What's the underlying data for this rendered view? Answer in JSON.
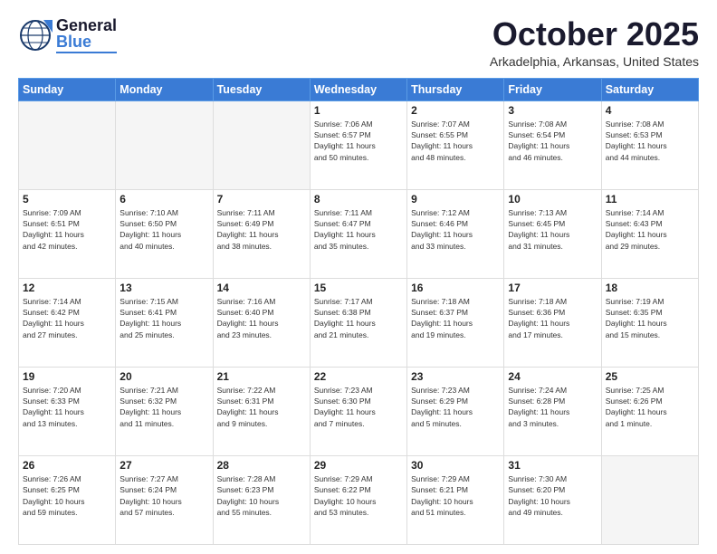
{
  "header": {
    "logo_general": "General",
    "logo_blue": "Blue",
    "month_title": "October 2025",
    "location": "Arkadelphia, Arkansas, United States"
  },
  "days_of_week": [
    "Sunday",
    "Monday",
    "Tuesday",
    "Wednesday",
    "Thursday",
    "Friday",
    "Saturday"
  ],
  "weeks": [
    [
      {
        "day": "",
        "info": ""
      },
      {
        "day": "",
        "info": ""
      },
      {
        "day": "",
        "info": ""
      },
      {
        "day": "1",
        "info": "Sunrise: 7:06 AM\nSunset: 6:57 PM\nDaylight: 11 hours\nand 50 minutes."
      },
      {
        "day": "2",
        "info": "Sunrise: 7:07 AM\nSunset: 6:55 PM\nDaylight: 11 hours\nand 48 minutes."
      },
      {
        "day": "3",
        "info": "Sunrise: 7:08 AM\nSunset: 6:54 PM\nDaylight: 11 hours\nand 46 minutes."
      },
      {
        "day": "4",
        "info": "Sunrise: 7:08 AM\nSunset: 6:53 PM\nDaylight: 11 hours\nand 44 minutes."
      }
    ],
    [
      {
        "day": "5",
        "info": "Sunrise: 7:09 AM\nSunset: 6:51 PM\nDaylight: 11 hours\nand 42 minutes."
      },
      {
        "day": "6",
        "info": "Sunrise: 7:10 AM\nSunset: 6:50 PM\nDaylight: 11 hours\nand 40 minutes."
      },
      {
        "day": "7",
        "info": "Sunrise: 7:11 AM\nSunset: 6:49 PM\nDaylight: 11 hours\nand 38 minutes."
      },
      {
        "day": "8",
        "info": "Sunrise: 7:11 AM\nSunset: 6:47 PM\nDaylight: 11 hours\nand 35 minutes."
      },
      {
        "day": "9",
        "info": "Sunrise: 7:12 AM\nSunset: 6:46 PM\nDaylight: 11 hours\nand 33 minutes."
      },
      {
        "day": "10",
        "info": "Sunrise: 7:13 AM\nSunset: 6:45 PM\nDaylight: 11 hours\nand 31 minutes."
      },
      {
        "day": "11",
        "info": "Sunrise: 7:14 AM\nSunset: 6:43 PM\nDaylight: 11 hours\nand 29 minutes."
      }
    ],
    [
      {
        "day": "12",
        "info": "Sunrise: 7:14 AM\nSunset: 6:42 PM\nDaylight: 11 hours\nand 27 minutes."
      },
      {
        "day": "13",
        "info": "Sunrise: 7:15 AM\nSunset: 6:41 PM\nDaylight: 11 hours\nand 25 minutes."
      },
      {
        "day": "14",
        "info": "Sunrise: 7:16 AM\nSunset: 6:40 PM\nDaylight: 11 hours\nand 23 minutes."
      },
      {
        "day": "15",
        "info": "Sunrise: 7:17 AM\nSunset: 6:38 PM\nDaylight: 11 hours\nand 21 minutes."
      },
      {
        "day": "16",
        "info": "Sunrise: 7:18 AM\nSunset: 6:37 PM\nDaylight: 11 hours\nand 19 minutes."
      },
      {
        "day": "17",
        "info": "Sunrise: 7:18 AM\nSunset: 6:36 PM\nDaylight: 11 hours\nand 17 minutes."
      },
      {
        "day": "18",
        "info": "Sunrise: 7:19 AM\nSunset: 6:35 PM\nDaylight: 11 hours\nand 15 minutes."
      }
    ],
    [
      {
        "day": "19",
        "info": "Sunrise: 7:20 AM\nSunset: 6:33 PM\nDaylight: 11 hours\nand 13 minutes."
      },
      {
        "day": "20",
        "info": "Sunrise: 7:21 AM\nSunset: 6:32 PM\nDaylight: 11 hours\nand 11 minutes."
      },
      {
        "day": "21",
        "info": "Sunrise: 7:22 AM\nSunset: 6:31 PM\nDaylight: 11 hours\nand 9 minutes."
      },
      {
        "day": "22",
        "info": "Sunrise: 7:23 AM\nSunset: 6:30 PM\nDaylight: 11 hours\nand 7 minutes."
      },
      {
        "day": "23",
        "info": "Sunrise: 7:23 AM\nSunset: 6:29 PM\nDaylight: 11 hours\nand 5 minutes."
      },
      {
        "day": "24",
        "info": "Sunrise: 7:24 AM\nSunset: 6:28 PM\nDaylight: 11 hours\nand 3 minutes."
      },
      {
        "day": "25",
        "info": "Sunrise: 7:25 AM\nSunset: 6:26 PM\nDaylight: 11 hours\nand 1 minute."
      }
    ],
    [
      {
        "day": "26",
        "info": "Sunrise: 7:26 AM\nSunset: 6:25 PM\nDaylight: 10 hours\nand 59 minutes."
      },
      {
        "day": "27",
        "info": "Sunrise: 7:27 AM\nSunset: 6:24 PM\nDaylight: 10 hours\nand 57 minutes."
      },
      {
        "day": "28",
        "info": "Sunrise: 7:28 AM\nSunset: 6:23 PM\nDaylight: 10 hours\nand 55 minutes."
      },
      {
        "day": "29",
        "info": "Sunrise: 7:29 AM\nSunset: 6:22 PM\nDaylight: 10 hours\nand 53 minutes."
      },
      {
        "day": "30",
        "info": "Sunrise: 7:29 AM\nSunset: 6:21 PM\nDaylight: 10 hours\nand 51 minutes."
      },
      {
        "day": "31",
        "info": "Sunrise: 7:30 AM\nSunset: 6:20 PM\nDaylight: 10 hours\nand 49 minutes."
      },
      {
        "day": "",
        "info": ""
      }
    ]
  ]
}
